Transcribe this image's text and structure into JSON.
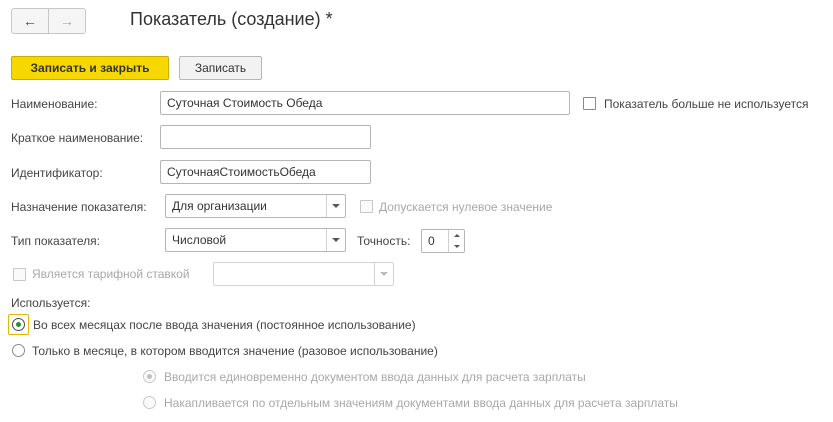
{
  "window": {
    "title": "Показатель (создание) *",
    "nav_back_icon": "arrow-left-icon",
    "nav_forward_icon": "arrow-right-icon"
  },
  "toolbar": {
    "save_close_label": "Записать и закрыть",
    "save_label": "Записать"
  },
  "form": {
    "name": {
      "label": "Наименование:",
      "value": "Суточная Стоимость Обеда"
    },
    "unused": {
      "label": "Показатель больше не используется",
      "checked": false
    },
    "short_name": {
      "label": "Краткое наименование:",
      "value": ""
    },
    "identifier": {
      "label": "Идентификатор:",
      "value": "СуточнаяСтоимостьОбеда"
    },
    "purpose": {
      "label": "Назначение показателя:",
      "value": "Для организации"
    },
    "zero_allowed": {
      "label": "Допускается нулевое значение",
      "checked": false,
      "disabled": true
    },
    "type": {
      "label": "Тип показателя:",
      "value": "Числовой"
    },
    "precision": {
      "label": "Точность:",
      "value": "0"
    },
    "tariff": {
      "label": "Является тарифной ставкой",
      "checked": false,
      "disabled": true,
      "select_value": ""
    }
  },
  "usage": {
    "label": "Используется:",
    "options": [
      {
        "label": "Во всех месяцах после ввода значения (постоянное использование)",
        "checked": true
      },
      {
        "label": "Только в месяце, в котором вводится значение (разовое использование)",
        "checked": false
      }
    ],
    "suboptions": [
      {
        "label": "Вводится единовременно документом ввода данных для расчета зарплаты",
        "checked": true,
        "disabled": true
      },
      {
        "label": "Накапливается по отдельным значениям документами ввода данных для расчета зарплаты",
        "checked": false,
        "disabled": true
      }
    ]
  },
  "colors": {
    "primary_button": "#f6d800",
    "radio_dot": "#2e8b3a",
    "focus_border": "#e4b900"
  }
}
